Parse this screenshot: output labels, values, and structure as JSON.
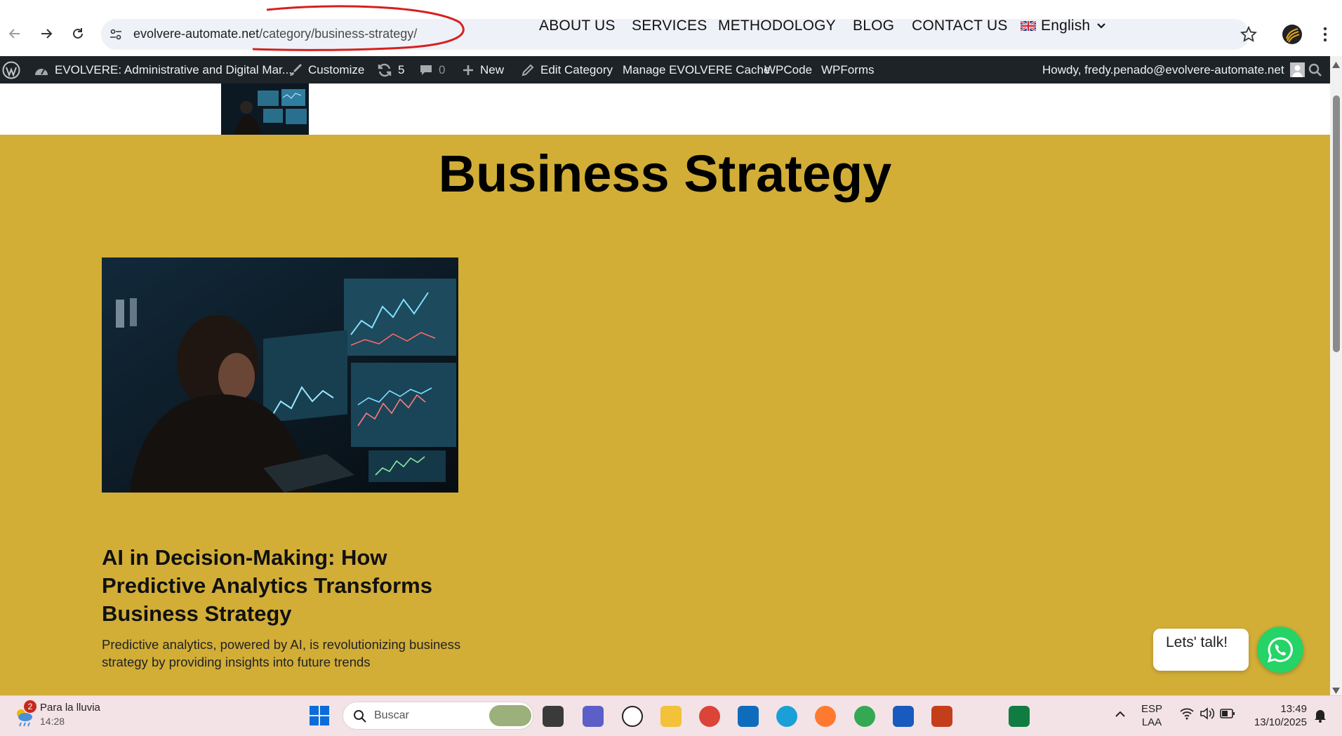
{
  "browser": {
    "url_host": "evolvere-automate.net",
    "url_path": "/category/business-strategy/"
  },
  "admin_bar": {
    "site_name": "EVOLVERE: Administrative and Digital Mar...",
    "customize": "Customize",
    "updates_count": "5",
    "comments_count": "0",
    "new_label": "New",
    "edit_category": "Edit Category",
    "cache": "Manage EVOLVERE Cache",
    "wpcode": "WPCode",
    "wpforms": "WPForms",
    "howdy": "Howdy, fredy.penado@evolvere-automate.net"
  },
  "site_nav": {
    "items": [
      "ABOUT US",
      "SERVICES",
      "METHODOLOGY",
      "BLOG",
      "CONTACT US"
    ],
    "language": "English"
  },
  "page": {
    "title": "Business Strategy"
  },
  "post": {
    "title": "AI in Decision-Making: How Predictive Analytics Transforms Business Strategy",
    "excerpt": "Predictive analytics, powered by AI, is revolutionizing business strategy by providing insights into future trends"
  },
  "chat": {
    "label": "Lets' talk!"
  },
  "taskbar": {
    "weather_title": "Para la lluvia",
    "weather_time": "14:28",
    "weather_badge": "2",
    "search_placeholder": "Buscar",
    "lang_top": "ESP",
    "lang_bottom": "LAA",
    "time": "13:49",
    "date": "13/10/2025"
  },
  "colors": {
    "page_bg": "#d2ae37",
    "admin_bar": "#1d2327",
    "whatsapp": "#25d366"
  }
}
